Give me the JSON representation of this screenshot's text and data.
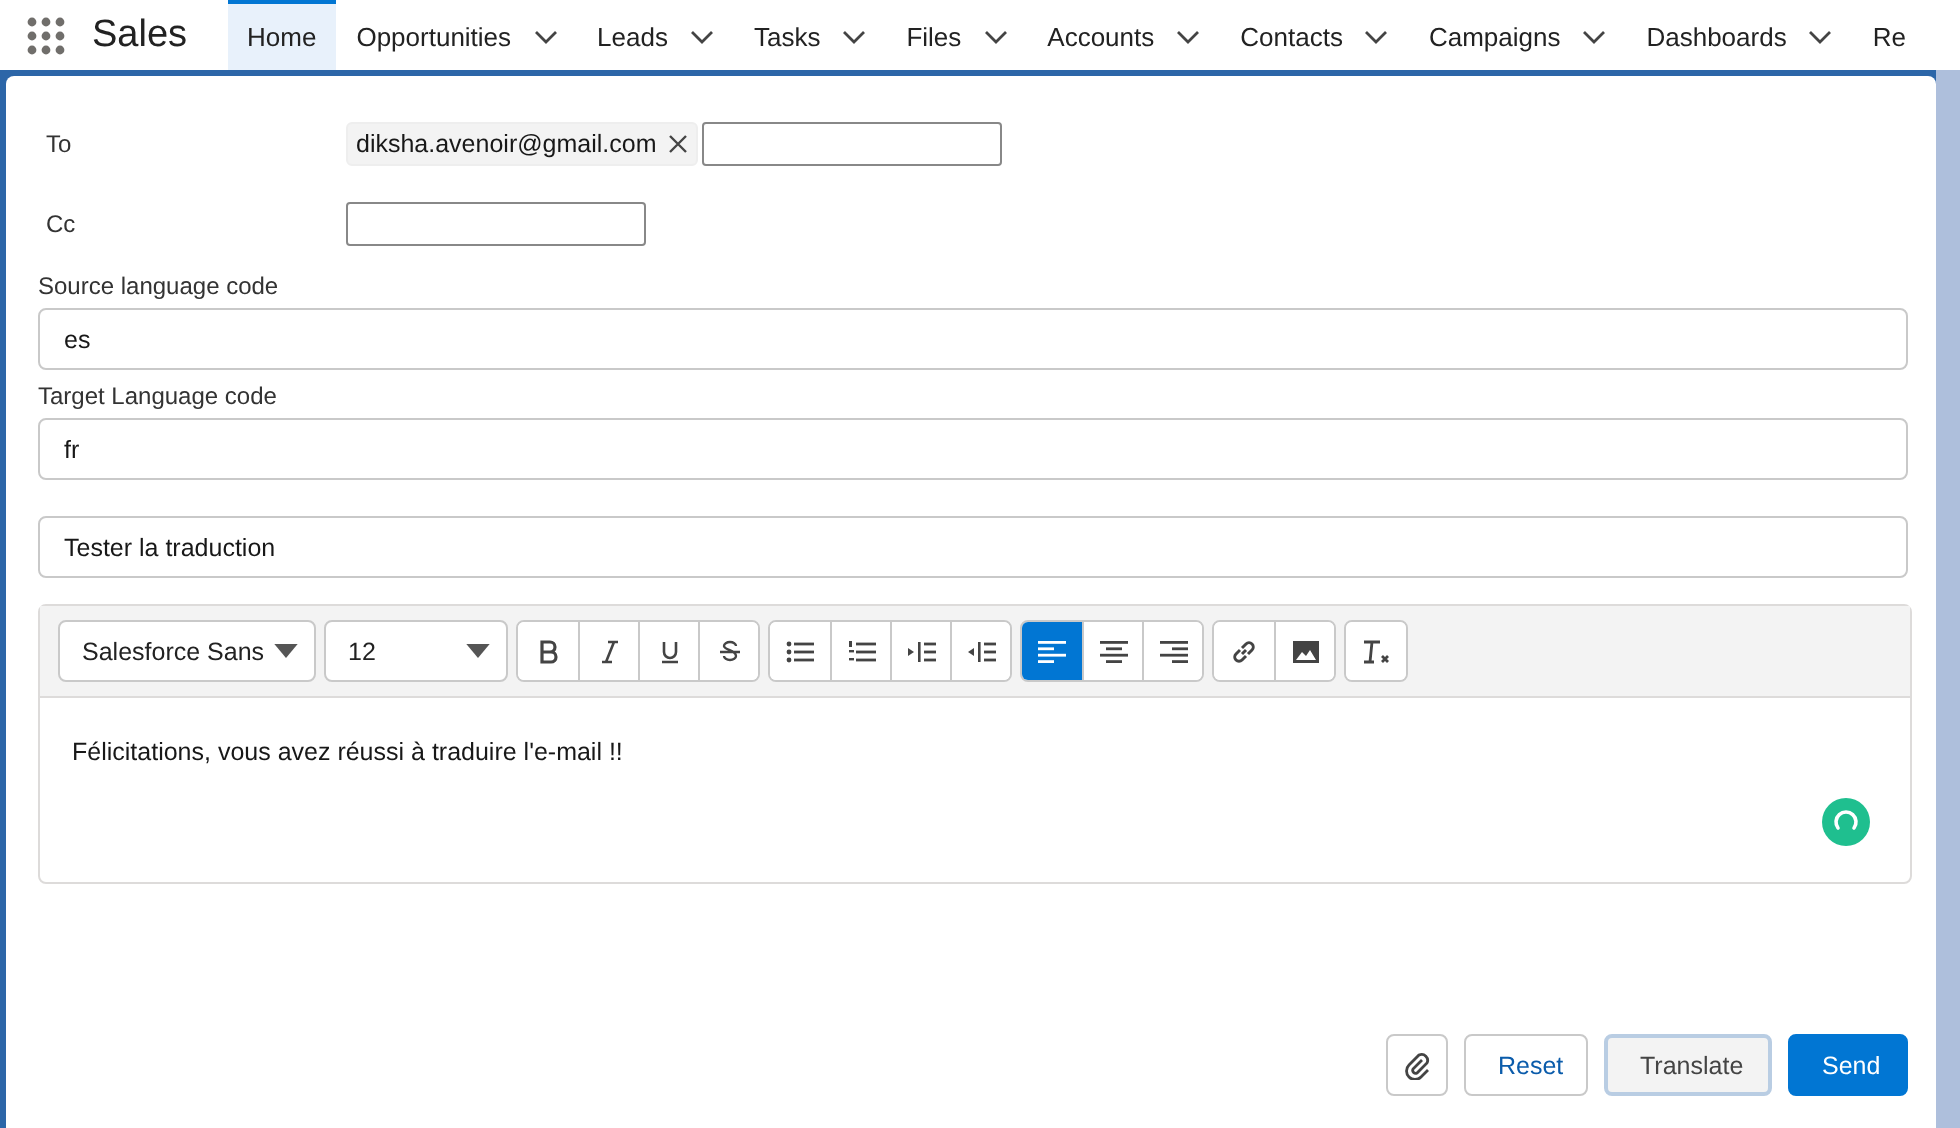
{
  "app": {
    "name": "Sales"
  },
  "nav": [
    {
      "label": "Home",
      "selected": true,
      "dropdown": false
    },
    {
      "label": "Opportunities",
      "selected": false,
      "dropdown": true
    },
    {
      "label": "Leads",
      "selected": false,
      "dropdown": true
    },
    {
      "label": "Tasks",
      "selected": false,
      "dropdown": true
    },
    {
      "label": "Files",
      "selected": false,
      "dropdown": true
    },
    {
      "label": "Accounts",
      "selected": false,
      "dropdown": true
    },
    {
      "label": "Contacts",
      "selected": false,
      "dropdown": true
    },
    {
      "label": "Campaigns",
      "selected": false,
      "dropdown": true
    },
    {
      "label": "Dashboards",
      "selected": false,
      "dropdown": true
    },
    {
      "label": "Re",
      "selected": false,
      "dropdown": false
    }
  ],
  "to": {
    "label": "To",
    "chips": [
      "diksha.avenoir@gmail.com"
    ]
  },
  "cc": {
    "label": "Cc"
  },
  "source": {
    "label": "Source language code",
    "value": "es"
  },
  "target": {
    "label": "Target Language code",
    "value": "fr"
  },
  "subject": {
    "value": "Tester la traduction"
  },
  "editor": {
    "font": "Salesforce Sans",
    "size": "12",
    "alignment": [
      {
        "selected": true
      },
      {
        "selected": false
      },
      {
        "selected": false
      }
    ],
    "body": "Félicitations, vous avez réussi à traduire l'e-mail !!"
  },
  "buttons": [
    {
      "label": "Reset",
      "kind": "neutral"
    },
    {
      "label": "Translate",
      "kind": "focused"
    },
    {
      "label": "Send",
      "kind": "brand"
    }
  ]
}
